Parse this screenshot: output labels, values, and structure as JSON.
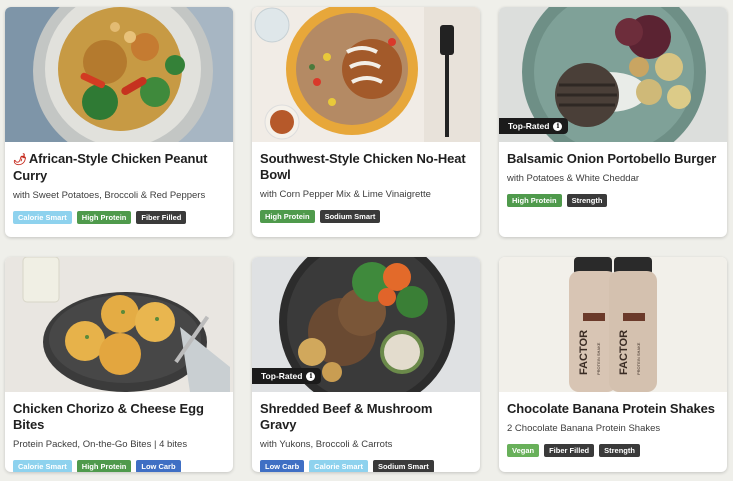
{
  "colors": {
    "calorie_smart": "#8ed2ee",
    "high_protein": "#4f9a4c",
    "fiber_filled": "#3a3a3a",
    "sodium_smart": "#3a3a3a",
    "strength": "#3a3a3a",
    "low_carb": "#3f6fc4",
    "vegan": "#68b05a"
  },
  "cards": [
    {
      "title": "African-Style Chicken Peanut Curry",
      "subtitle": "with Sweet Potatoes, Broccoli & Red Peppers",
      "icon": "chili-pepper-icon",
      "tags": [
        "Calorie Smart",
        "High Protein",
        "Fiber Filled"
      ]
    },
    {
      "title": "Southwest-Style Chicken No-Heat Bowl",
      "subtitle": "with Corn Pepper Mix & Lime Vinaigrette",
      "tags": [
        "High Protein",
        "Sodium Smart"
      ]
    },
    {
      "title": "Balsamic Onion Portobello Burger",
      "subtitle": "with Potatoes & White Cheddar",
      "badge": "Top-Rated",
      "tags": [
        "High Protein",
        "Strength"
      ]
    },
    {
      "title": "Chicken Chorizo & Cheese Egg Bites",
      "subtitle": "Protein Packed, On-the-Go Bites | 4 bites",
      "tags": [
        "Calorie Smart",
        "High Protein",
        "Low Carb"
      ]
    },
    {
      "title": "Shredded Beef & Mushroom Gravy",
      "subtitle": "with Yukons, Broccoli & Carrots",
      "badge": "Top-Rated",
      "tags": [
        "Low Carb",
        "Calorie Smart",
        "Sodium Smart"
      ]
    },
    {
      "title": "Chocolate Banana Protein Shakes",
      "subtitle": "2 Chocolate Banana Protein Shakes",
      "bottle_brand": "FACTOR",
      "bottle_label": "PROTEIN SHAKE",
      "tags": [
        "Vegan",
        "Fiber Filled",
        "Strength"
      ]
    }
  ]
}
